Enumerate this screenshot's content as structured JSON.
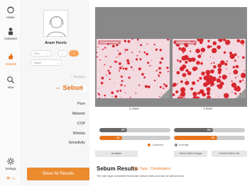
{
  "nav": {
    "items": [
      {
        "label": "Home",
        "icon": "home-icon"
      },
      {
        "label": "Customer",
        "icon": "person-icon"
      },
      {
        "label": "Analysis",
        "icon": "flame-icon"
      },
      {
        "label": "View",
        "icon": "search-icon"
      },
      {
        "label": "Settings",
        "icon": "gear-icon"
      }
    ],
    "active": "Analysis",
    "footer_icons": [
      "wifi-icon",
      "home-icon"
    ]
  },
  "profile": {
    "name": "Aram Huvis",
    "age": "20's",
    "gender_options": [
      "♂",
      "♀"
    ],
    "selected_gender": "♀",
    "region": "Asian"
  },
  "menu": {
    "items": [
      "Moisture",
      "Sebum",
      "Pore",
      "Melanin",
      "COP",
      "Wrinkle",
      "Sensitivity"
    ],
    "active": "Sebum",
    "show_all_label": "Show All Results"
  },
  "analysis": {
    "left_image_tag": "Analysis Image",
    "right_image_tag": "Analysis Image",
    "left_zone_label": "U Zone",
    "right_zone_label": "T Zone",
    "u_zone_bars": {
      "customer": 32,
      "average": 39
    },
    "t_zone_bars": {
      "customer": 61,
      "average": 55
    },
    "legend_customer": "Customer",
    "legend_average": "Average",
    "buttons": {
      "analysis": "Analysis",
      "show_taken_image": "Show Taken Image",
      "control_menu": "Control Menu On"
    }
  },
  "results": {
    "title": "Sebum Results",
    "skin_type": "Skin Type : Combination",
    "description": "The skin type combined Excessive sebum area and lack of sebum area."
  },
  "colors": {
    "accent": "#e8731b",
    "sebum_spot": "#d8262e",
    "zone_bg": "#f3d9e0",
    "viewer_bg": "#888888"
  }
}
